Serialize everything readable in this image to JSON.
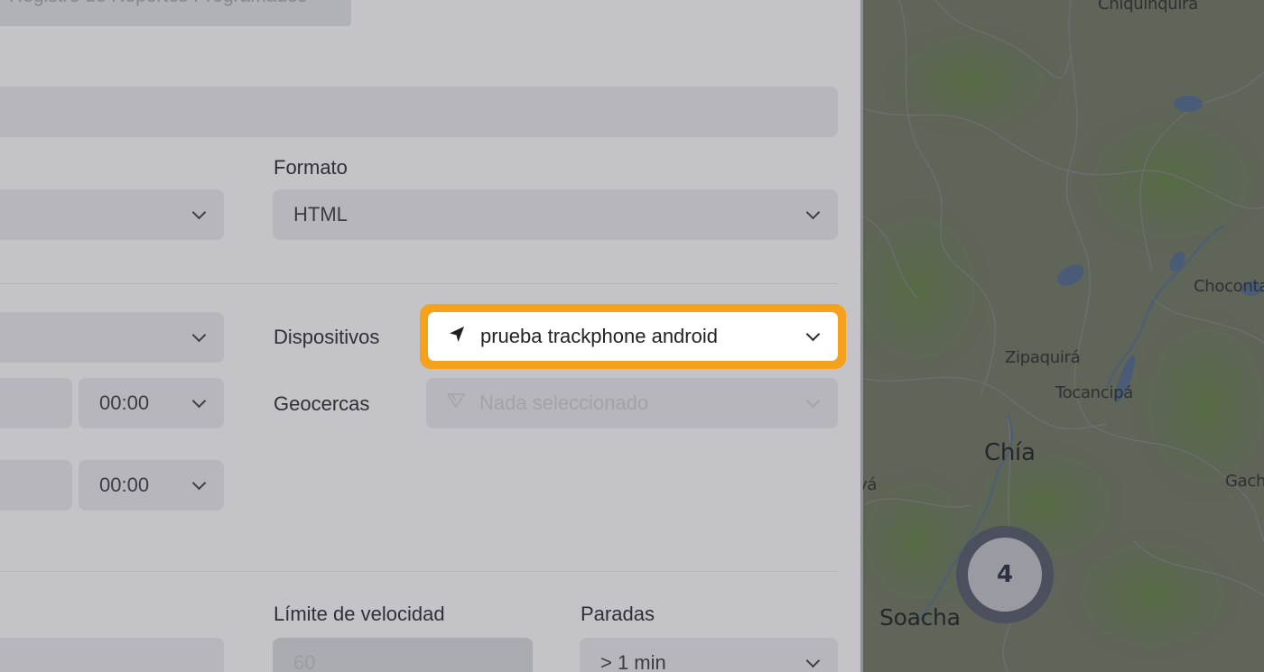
{
  "tab": {
    "label": "Registro de Reportes Programados"
  },
  "format": {
    "label": "Formato",
    "value": "HTML"
  },
  "devices": {
    "label": "Dispositivos",
    "value": "prueba trackphone android",
    "icon": "navigation-arrow-icon"
  },
  "geofences": {
    "label": "Geocercas",
    "placeholder": "Nada seleccionado",
    "icon": "geofence-triangle-icon"
  },
  "time_from": {
    "value": "00:00"
  },
  "time_to": {
    "value": "00:00"
  },
  "speed_limit": {
    "label": "Límite de velocidad",
    "placeholder": "60"
  },
  "stops": {
    "label": "Paradas",
    "value": "> 1 min"
  },
  "map": {
    "cities": [
      "Chiquinquirá",
      "Choconta",
      "Zipaquirá",
      "Tocancipá",
      "Chía",
      "Gach",
      "vá",
      "Soacha"
    ],
    "cluster_count": "4"
  },
  "colors": {
    "highlight": "#f5a11b",
    "overlay": "#c3c3c8"
  }
}
